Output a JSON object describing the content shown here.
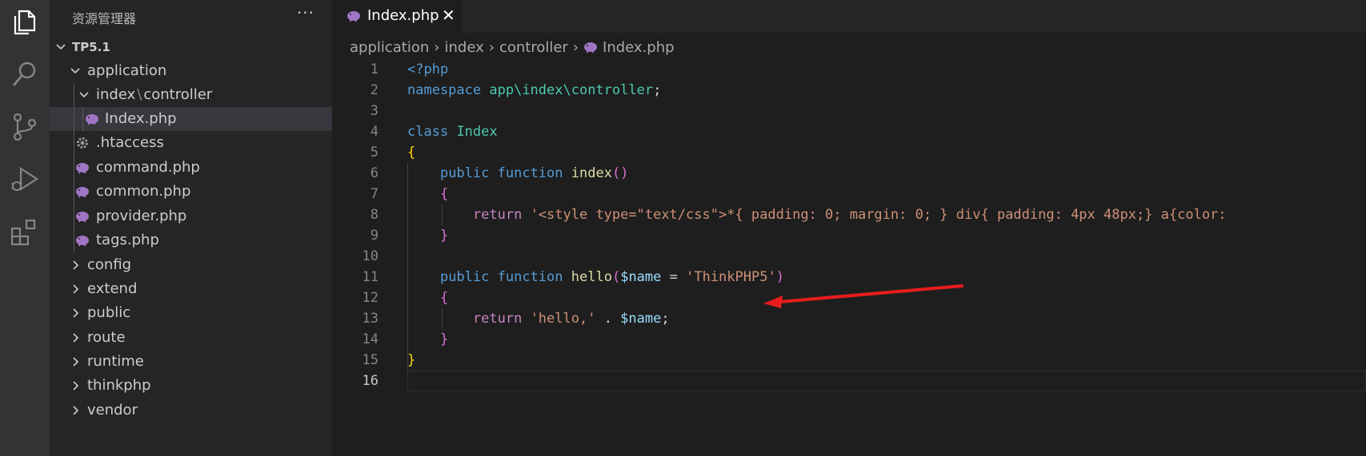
{
  "sidebar": {
    "title": "资源管理器",
    "more": "···",
    "tree": [
      {
        "label": "TP5.1",
        "kind": "root"
      },
      {
        "label": "application",
        "kind": "folder-open"
      },
      {
        "label_a": "index",
        "label_sep": "\\",
        "label_b": "controller",
        "kind": "folder-open"
      },
      {
        "label": "Index.php",
        "kind": "php",
        "selected": true
      },
      {
        "label": ".htaccess",
        "kind": "gear"
      },
      {
        "label": "command.php",
        "kind": "php"
      },
      {
        "label": "common.php",
        "kind": "php"
      },
      {
        "label": "provider.php",
        "kind": "php"
      },
      {
        "label": "tags.php",
        "kind": "php"
      },
      {
        "label": "config",
        "kind": "folder"
      },
      {
        "label": "extend",
        "kind": "folder"
      },
      {
        "label": "public",
        "kind": "folder"
      },
      {
        "label": "route",
        "kind": "folder"
      },
      {
        "label": "runtime",
        "kind": "folder"
      },
      {
        "label": "thinkphp",
        "kind": "folder"
      },
      {
        "label": "vendor",
        "kind": "folder"
      }
    ]
  },
  "tab": {
    "label": "Index.php",
    "close": "✕"
  },
  "breadcrumb": [
    "application",
    "index",
    "controller",
    "Index.php"
  ],
  "editor": {
    "line_numbers": [
      "1",
      "2",
      "3",
      "4",
      "5",
      "6",
      "7",
      "8",
      "9",
      "10",
      "11",
      "12",
      "13",
      "14",
      "15",
      "16"
    ],
    "lines": {
      "l1": {
        "a": "<?php"
      },
      "l2": {
        "a": "namespace",
        "b": "app\\index\\controller",
        "c": ";"
      },
      "l4": {
        "a": "class",
        "b": "Index"
      },
      "l5": {
        "a": "{"
      },
      "l6": {
        "a": "public",
        "b": "function",
        "c": "index",
        "d": "()"
      },
      "l7": {
        "a": "{"
      },
      "l8": {
        "a": "return",
        "b": "'<style type=\"text/css\">*{ padding: 0; margin: 0; } div{ padding: 4px 48px;} a{color:"
      },
      "l9": {
        "a": "}"
      },
      "l11": {
        "a": "public",
        "b": "function",
        "c": "hello",
        "d": "(",
        "e": "$name",
        "f": " = ",
        "g": "'ThinkPHP5'",
        "h": ")"
      },
      "l12": {
        "a": "{"
      },
      "l13": {
        "a": "return",
        "b": "'hello,'",
        "c": " . ",
        "d": "$name",
        "e": ";"
      },
      "l14": {
        "a": "}"
      },
      "l15": {
        "a": "}"
      }
    }
  },
  "colors": {
    "activity_bar": "#333333",
    "sidebar": "#252526",
    "editor": "#1e1e1e",
    "php_icon": "#a074c4",
    "annotation_arrow": "#e81c1c"
  },
  "icons": [
    "files-icon",
    "search-icon",
    "source-control-icon",
    "run-debug-icon",
    "extensions-icon",
    "php-elephant-icon",
    "gear-icon",
    "chevron-down-icon",
    "chevron-right-icon",
    "close-icon"
  ]
}
